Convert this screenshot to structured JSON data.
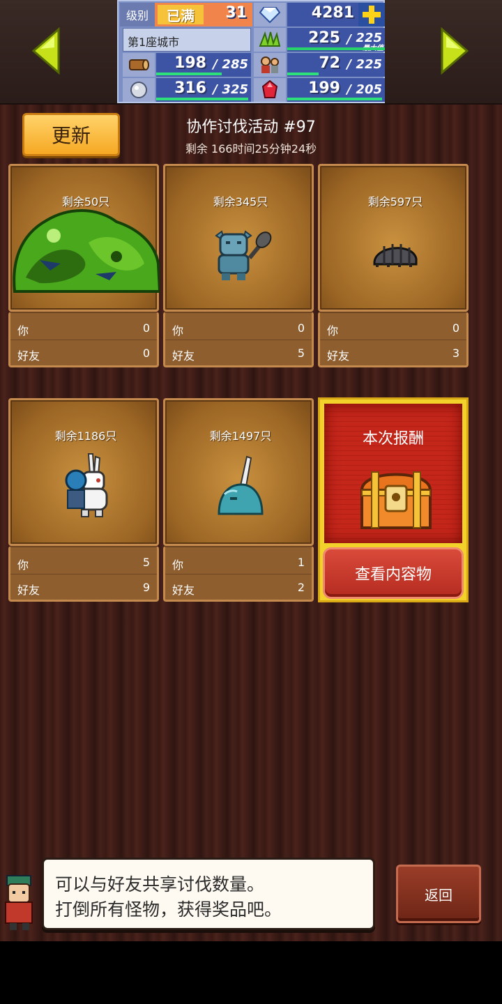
{
  "header": {
    "level_label": "级别",
    "level_badge": "已满",
    "level_value": "31",
    "gems": "4281",
    "city_name": "第1座城市",
    "food_current": "225",
    "food_max": "225",
    "food_max_note": "最大值",
    "wood_current": "198",
    "wood_max": "285",
    "people_current": "72",
    "people_max": "225",
    "ore_current": "316",
    "ore_max": "325",
    "crystal_current": "199",
    "crystal_max": "205",
    "slash": "/",
    "icons": [
      "diamond-icon",
      "plus-icon",
      "grass-icon",
      "wood-log-icon",
      "townsfolk-icon",
      "ore-icon",
      "red-crystal-icon"
    ]
  },
  "toolbar": {
    "update_label": "更新"
  },
  "event": {
    "title": "协作讨伐活动 #97",
    "remaining": "剩余 166时间25分钟24秒"
  },
  "labels": {
    "you": "你",
    "friends": "好友"
  },
  "monsters": [
    {
      "remaining": "剩余50只",
      "you": "0",
      "friends": "0",
      "sprite": "green-slime-boss"
    },
    {
      "remaining": "剩余345只",
      "you": "0",
      "friends": "5",
      "sprite": "blue-goblin-club"
    },
    {
      "remaining": "剩余597只",
      "you": "0",
      "friends": "3",
      "sprite": "grey-pillbug"
    },
    {
      "remaining": "剩余1186只",
      "you": "5",
      "friends": "9",
      "sprite": "knight-rabbit"
    },
    {
      "remaining": "剩余1497只",
      "you": "1",
      "friends": "2",
      "sprite": "horned-slime"
    }
  ],
  "reward": {
    "title": "本次报酬",
    "button_label": "查看内容物"
  },
  "dialog": {
    "line1": "可以与好友共享讨伐数量。",
    "line2": "打倒所有怪物，获得奖品吧。"
  },
  "back_label": "返回",
  "colors": {
    "accent_gold": "#f6a823",
    "reward_red": "#c4261a",
    "panel_blue": "#7b8fc4"
  }
}
